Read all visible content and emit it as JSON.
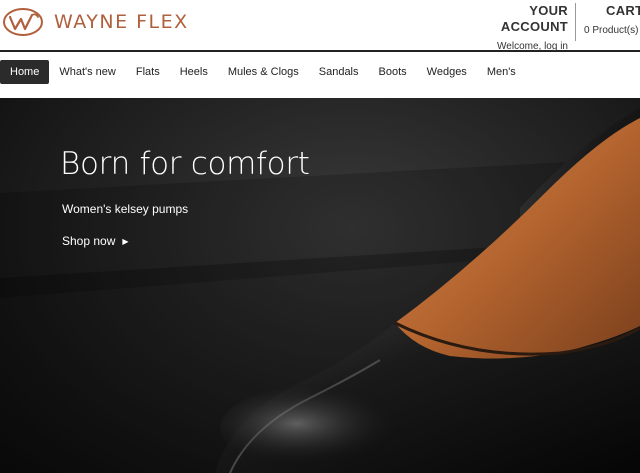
{
  "brand": {
    "name": "WAYNE FLEX",
    "color": "#b0603c"
  },
  "account": {
    "title": "YOUR ACCOUNT",
    "subtitle": "Welcome, log in"
  },
  "cart": {
    "title": "CART",
    "subtitle": "0 Product(s)"
  },
  "nav": {
    "items": [
      {
        "label": "Home",
        "active": true
      },
      {
        "label": "What's new"
      },
      {
        "label": "Flats"
      },
      {
        "label": "Heels"
      },
      {
        "label": "Mules & Clogs"
      },
      {
        "label": "Sandals"
      },
      {
        "label": "Boots"
      },
      {
        "label": "Wedges"
      },
      {
        "label": "Men's"
      }
    ]
  },
  "hero": {
    "title": "Born for comfort",
    "subtitle": "Women's kelsey pumps",
    "cta": "Shop now",
    "cta_icon": "triangle-right-icon"
  }
}
